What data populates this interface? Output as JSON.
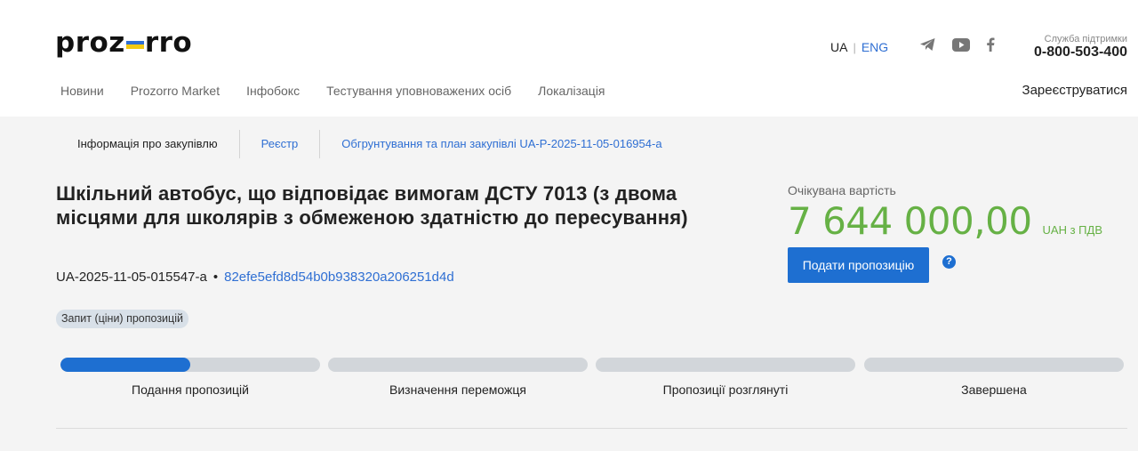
{
  "brand": {
    "logo_left": "proz",
    "logo_right": "rro"
  },
  "header": {
    "lang_ua": "UA",
    "lang_eng": "ENG",
    "support_label": "Служба підтримки",
    "support_phone": "0-800-503-400",
    "register": "Зареєструватися",
    "social_icons": [
      "telegram-icon",
      "youtube-icon",
      "facebook-icon"
    ]
  },
  "nav": {
    "items": [
      "Новини",
      "Prozorro Market",
      "Інфобокс",
      "Тестування уповноважених осіб",
      "Локалізація"
    ]
  },
  "tabs": {
    "info": "Інформація про закупівлю",
    "registry": "Реєстр",
    "plan": "Обгрунтування та план закупівлі UA-P-2025-11-05-016954-a"
  },
  "tender": {
    "title": "Шкільний автобус, що відповідає вимогам ДСТУ 7013 (з двома місцями для школярів з обмеженою здатністю до пересування)",
    "id": "UA-2025-11-05-015547-a",
    "bullet": "•",
    "hash": "82efe5efd8d54b0b938320a206251d4d",
    "type_badge": "Запит (ціни) пропозицій"
  },
  "value": {
    "label": "Очікувана вартість",
    "amount": "7 644 000,00",
    "currency": "UAH з ПДВ",
    "submit_button": "Подати пропозицію",
    "help": "?"
  },
  "stages": [
    {
      "label": "Подання пропозицій",
      "progress": 0.5
    },
    {
      "label": "Визначення переможця",
      "progress": 0
    },
    {
      "label": "Пропозиції розглянуті",
      "progress": 0
    },
    {
      "label": "Завершена",
      "progress": 0
    }
  ],
  "colors": {
    "accent": "#1e6fd1",
    "value_green": "#66b145",
    "link": "#2f6fd3"
  }
}
